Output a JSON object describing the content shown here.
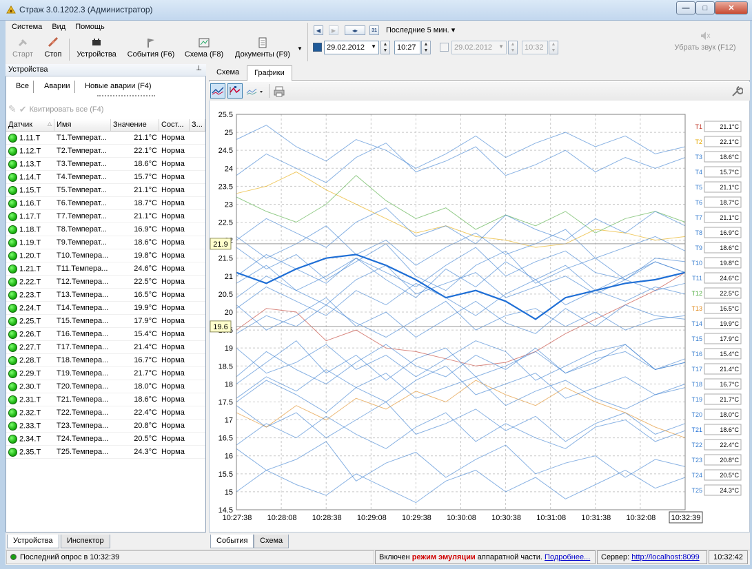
{
  "window": {
    "title": "Страж 3.0.1202.3 (Администратор)"
  },
  "menu": [
    "Система",
    "Вид",
    "Помощь"
  ],
  "toolbar": {
    "start": "Старт",
    "stop": "Стоп",
    "devices": "Устройства",
    "events": "События (F6)",
    "scheme": "Схема (F8)",
    "docs": "Документы (F9)",
    "mute": "Убрать звук (F12)"
  },
  "period": {
    "label": "Последние 5 мин.",
    "date_from": "29.02.2012",
    "time_from": "10:27",
    "date_to": "29.02.2012",
    "time_to": "10:32",
    "calendar_day": "31"
  },
  "left": {
    "header": "Устройства",
    "tabs": [
      "Все",
      "Аварии",
      "Новые аварии (F4)"
    ],
    "ack_all": "Квитировать все (F4)",
    "columns": [
      "Датчик",
      "Имя",
      "Значение",
      "Сост...",
      "З..."
    ],
    "rows": [
      [
        "1.11.T",
        "T1.Температ...",
        "21.1°C",
        "Норма"
      ],
      [
        "1.12.T",
        "T2.Температ...",
        "22.1°C",
        "Норма"
      ],
      [
        "1.13.T",
        "T3.Температ...",
        "18.6°C",
        "Норма"
      ],
      [
        "1.14.T",
        "T4.Температ...",
        "15.7°C",
        "Норма"
      ],
      [
        "1.15.T",
        "T5.Температ...",
        "21.1°C",
        "Норма"
      ],
      [
        "1.16.T",
        "T6.Температ...",
        "18.7°C",
        "Норма"
      ],
      [
        "1.17.T",
        "T7.Температ...",
        "21.1°C",
        "Норма"
      ],
      [
        "1.18.T",
        "T8.Температ...",
        "16.9°C",
        "Норма"
      ],
      [
        "1.19.T",
        "T9.Температ...",
        "18.6°C",
        "Норма"
      ],
      [
        "1.20.T",
        "T10.Темпера...",
        "19.8°C",
        "Норма"
      ],
      [
        "1.21.T",
        "T11.Темпера...",
        "24.6°C",
        "Норма"
      ],
      [
        "2.22.T",
        "T12.Темпера...",
        "22.5°C",
        "Норма"
      ],
      [
        "2.23.T",
        "T13.Темпера...",
        "16.5°C",
        "Норма"
      ],
      [
        "2.24.T",
        "T14.Темпера...",
        "19.9°C",
        "Норма"
      ],
      [
        "2.25.T",
        "T15.Темпера...",
        "17.9°C",
        "Норма"
      ],
      [
        "2.26.T",
        "T16.Темпера...",
        "15.4°C",
        "Норма"
      ],
      [
        "2.27.T",
        "T17.Темпера...",
        "21.4°C",
        "Норма"
      ],
      [
        "2.28.T",
        "T18.Темпера...",
        "16.7°C",
        "Норма"
      ],
      [
        "2.29.T",
        "T19.Темпера...",
        "21.7°C",
        "Норма"
      ],
      [
        "2.30.T",
        "T20.Темпера...",
        "18.0°C",
        "Норма"
      ],
      [
        "2.31.T",
        "T21.Темпера...",
        "18.6°C",
        "Норма"
      ],
      [
        "2.32.T",
        "T22.Темпера...",
        "22.4°C",
        "Норма"
      ],
      [
        "2.33.T",
        "T23.Темпера...",
        "20.8°C",
        "Норма"
      ],
      [
        "2.34.T",
        "T24.Темпера...",
        "20.5°C",
        "Норма"
      ],
      [
        "2.35.T",
        "T25.Темпера...",
        "24.3°C",
        "Норма"
      ]
    ],
    "bottom_tabs": [
      "Устройства",
      "Инспектор"
    ]
  },
  "main": {
    "tabs": [
      "Схема",
      "Графики"
    ],
    "bottom_tabs": [
      "События",
      "Схема"
    ]
  },
  "status": {
    "last_poll": "Последний опрос в 10:32:39",
    "emul_prefix": "Включен",
    "emul_bold": "режим эмуляции",
    "emul_suffix": "аппаратной части.",
    "more": "Подробнее...",
    "server_label": "Сервер:",
    "server_url": "http://localhost:8099",
    "clock": "10:32:42"
  },
  "chart_data": {
    "type": "line",
    "ylim": [
      14.5,
      25.5
    ],
    "yticks": [
      "25.5",
      "25",
      "24.5",
      "24",
      "23.5",
      "23",
      "22.5",
      "22",
      "21.5",
      "21",
      "20.5",
      "20",
      "19.5",
      "19",
      "18.5",
      "18",
      "17.5",
      "17",
      "16.5",
      "16",
      "15.5",
      "15",
      "14.5"
    ],
    "xticks": [
      "10:27:38",
      "10:28:08",
      "10:28:38",
      "10:29:08",
      "10:29:38",
      "10:30:08",
      "10:30:38",
      "10:31:08",
      "10:31:38",
      "10:32:08",
      "10:32:39"
    ],
    "markers": [
      21.9,
      19.6
    ],
    "series": [
      {
        "name": "T1",
        "color": "#c0392b",
        "value": "21.1°C",
        "values": [
          19.5,
          20.1,
          20.0,
          19.2,
          19.5,
          19.0,
          18.9,
          18.7,
          18.5,
          18.6,
          18.9,
          19.4,
          19.8,
          20.2,
          20.6,
          21.1
        ]
      },
      {
        "name": "T2",
        "color": "#e6a800",
        "value": "22.1°C",
        "values": [
          23.3,
          23.5,
          23.9,
          23.4,
          23.0,
          22.6,
          22.2,
          22.4,
          22.1,
          22.0,
          21.8,
          21.9,
          22.3,
          22.2,
          22.0,
          22.1
        ]
      },
      {
        "name": "T3",
        "color": "#3a7fd0",
        "value": "18.6°C",
        "values": [
          19.0,
          18.3,
          18.6,
          19.1,
          18.4,
          18.8,
          18.2,
          18.7,
          19.2,
          18.9,
          18.1,
          18.5,
          18.9,
          19.1,
          18.4,
          18.6
        ]
      },
      {
        "name": "T4",
        "color": "#3a7fd0",
        "value": "15.7°C",
        "values": [
          16.2,
          15.6,
          15.9,
          16.4,
          15.3,
          15.8,
          16.1,
          15.4,
          15.9,
          16.3,
          15.5,
          15.8,
          16.0,
          15.4,
          15.9,
          15.7
        ]
      },
      {
        "name": "T5",
        "color": "#3a7fd0",
        "value": "21.1°C",
        "values": [
          20.8,
          21.3,
          20.6,
          21.0,
          21.5,
          20.9,
          20.4,
          21.2,
          20.7,
          21.4,
          20.9,
          21.3,
          20.6,
          21.0,
          21.4,
          21.1
        ]
      },
      {
        "name": "T6",
        "color": "#3a7fd0",
        "value": "18.7°C",
        "values": [
          18.2,
          18.9,
          18.4,
          18.0,
          18.6,
          19.1,
          18.5,
          18.2,
          18.8,
          18.4,
          19.0,
          18.3,
          18.7,
          18.9,
          18.4,
          18.7
        ]
      },
      {
        "name": "T7",
        "color": "#3a7fd0",
        "value": "21.1°C",
        "values": [
          21.8,
          21.2,
          21.6,
          20.9,
          21.4,
          21.9,
          21.0,
          20.6,
          21.3,
          21.7,
          20.8,
          21.2,
          21.5,
          20.9,
          21.4,
          21.1
        ]
      },
      {
        "name": "T8",
        "color": "#3a7fd0",
        "value": "16.9°C",
        "values": [
          17.4,
          16.8,
          17.2,
          16.5,
          17.0,
          17.5,
          16.6,
          16.9,
          17.3,
          16.7,
          17.1,
          16.4,
          16.9,
          17.2,
          16.6,
          16.9
        ]
      },
      {
        "name": "T9",
        "color": "#3a7fd0",
        "value": "18.6°C",
        "values": [
          18.0,
          18.6,
          19.2,
          18.3,
          18.8,
          18.1,
          18.7,
          19.0,
          18.2,
          18.5,
          18.9,
          18.3,
          18.6,
          19.1,
          18.4,
          18.6
        ]
      },
      {
        "name": "T10",
        "color": "#3a7fd0",
        "value": "19.8°C",
        "values": [
          20.2,
          19.5,
          19.9,
          20.4,
          19.6,
          20.0,
          19.3,
          19.8,
          20.3,
          19.7,
          19.4,
          20.1,
          19.6,
          20.2,
          19.9,
          19.8
        ]
      },
      {
        "name": "T11",
        "color": "#3a7fd0",
        "value": "24.6°C",
        "values": [
          24.8,
          25.2,
          24.6,
          24.2,
          24.8,
          24.5,
          24.0,
          24.4,
          24.9,
          24.3,
          24.7,
          25.0,
          24.6,
          24.9,
          24.4,
          24.6
        ]
      },
      {
        "name": "T12",
        "color": "#4caa3c",
        "value": "22.5°C",
        "values": [
          23.2,
          22.8,
          22.5,
          23.0,
          23.8,
          23.1,
          22.6,
          22.9,
          22.3,
          22.7,
          22.4,
          22.8,
          22.2,
          22.6,
          22.8,
          22.5
        ]
      },
      {
        "name": "T13",
        "color": "#e08a1e",
        "value": "16.5°C",
        "values": [
          17.2,
          16.8,
          17.4,
          17.0,
          17.6,
          17.3,
          17.8,
          17.5,
          18.1,
          17.7,
          17.4,
          17.9,
          17.5,
          17.2,
          16.8,
          16.5
        ]
      },
      {
        "name": "T14",
        "color": "#3a7fd0",
        "value": "19.9°C",
        "values": [
          19.4,
          19.9,
          19.6,
          20.2,
          19.7,
          19.3,
          19.8,
          20.3,
          19.5,
          19.9,
          20.1,
          19.6,
          20.0,
          19.5,
          19.8,
          19.9
        ]
      },
      {
        "name": "T15",
        "color": "#3a7fd0",
        "value": "17.9°C",
        "values": [
          17.5,
          18.1,
          17.7,
          17.2,
          17.9,
          18.3,
          17.6,
          17.9,
          18.2,
          17.4,
          17.8,
          18.1,
          17.6,
          17.3,
          17.7,
          17.9
        ]
      },
      {
        "name": "T16",
        "color": "#3a7fd0",
        "value": "15.4°C",
        "values": [
          15.0,
          15.6,
          15.2,
          14.9,
          15.5,
          15.1,
          14.7,
          15.3,
          15.6,
          15.0,
          15.4,
          14.8,
          15.2,
          15.6,
          15.1,
          15.4
        ]
      },
      {
        "name": "T17",
        "color": "#3a7fd0",
        "value": "21.4°C",
        "values": [
          21.0,
          21.6,
          21.2,
          20.8,
          21.5,
          21.1,
          20.7,
          21.3,
          21.8,
          21.0,
          21.4,
          21.7,
          21.1,
          20.9,
          21.5,
          21.4
        ]
      },
      {
        "name": "T18",
        "color": "#3a7fd0",
        "value": "16.7°C",
        "values": [
          16.3,
          16.9,
          16.5,
          17.1,
          16.6,
          16.2,
          16.8,
          17.2,
          16.4,
          16.9,
          16.5,
          16.2,
          16.8,
          17.0,
          16.4,
          16.7
        ]
      },
      {
        "name": "T19",
        "color": "#3a7fd0",
        "value": "21.7°C",
        "values": [
          22.1,
          21.5,
          21.9,
          22.4,
          21.6,
          22.0,
          21.3,
          21.8,
          22.2,
          21.6,
          21.9,
          22.3,
          21.5,
          21.8,
          22.1,
          21.7
        ]
      },
      {
        "name": "T20",
        "color": "#3a7fd0",
        "value": "18.0°C",
        "values": [
          17.6,
          18.2,
          17.8,
          18.4,
          17.9,
          17.5,
          18.1,
          18.5,
          17.7,
          18.0,
          18.3,
          17.6,
          17.9,
          18.2,
          17.7,
          18.0
        ]
      },
      {
        "name": "T21",
        "color": "#1f6fd6",
        "value": "18.6°C",
        "values": [
          21.1,
          20.8,
          21.2,
          21.5,
          21.6,
          21.3,
          20.9,
          20.4,
          20.6,
          20.3,
          19.8,
          20.4,
          20.6,
          20.8,
          20.9,
          21.1
        ],
        "bold": true
      },
      {
        "name": "T22",
        "color": "#3a7fd0",
        "value": "22.4°C",
        "values": [
          22.0,
          22.6,
          22.2,
          21.8,
          22.5,
          22.9,
          22.1,
          22.4,
          21.9,
          22.7,
          22.3,
          22.0,
          22.6,
          22.2,
          22.8,
          22.4
        ]
      },
      {
        "name": "T23",
        "color": "#3a7fd0",
        "value": "20.8°C",
        "values": [
          20.4,
          21.0,
          20.6,
          20.2,
          20.9,
          21.3,
          20.5,
          20.8,
          21.1,
          20.4,
          20.7,
          21.0,
          20.5,
          20.9,
          20.6,
          20.8
        ]
      },
      {
        "name": "T24",
        "color": "#3a7fd0",
        "value": "20.5°C",
        "values": [
          20.1,
          20.7,
          20.3,
          19.9,
          20.6,
          20.2,
          20.8,
          20.4,
          19.9,
          20.5,
          20.9,
          20.2,
          20.6,
          20.3,
          20.7,
          20.5
        ]
      },
      {
        "name": "T25",
        "color": "#3a7fd0",
        "value": "24.3°C",
        "values": [
          23.8,
          24.4,
          24.0,
          23.6,
          24.3,
          24.7,
          23.9,
          24.2,
          24.6,
          23.8,
          24.1,
          24.5,
          23.9,
          24.3,
          24.0,
          24.3
        ]
      }
    ]
  }
}
